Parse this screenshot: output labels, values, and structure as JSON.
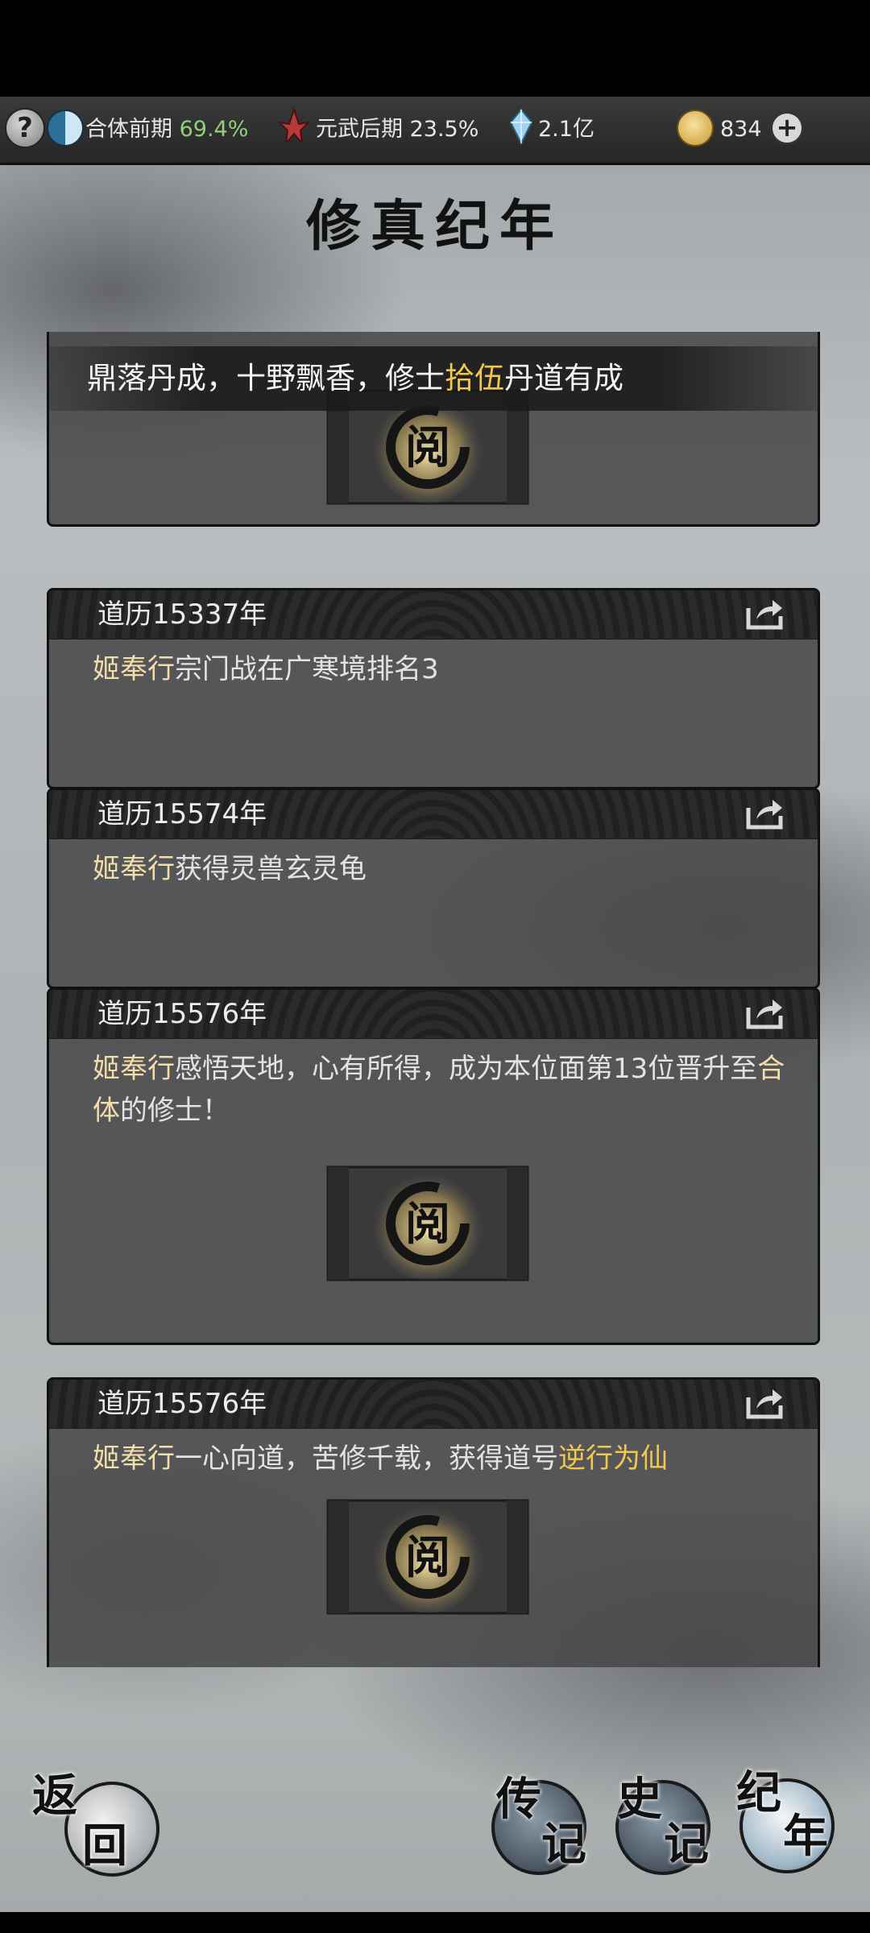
{
  "status_bar": {
    "cultivation_label": "合体前期",
    "cultivation_pct": "69.4%",
    "martial_label": "元武后期 23.5%",
    "spirit_stones": "2.1亿",
    "jade": "834",
    "help_glyph": "?",
    "plus_glyph": "+"
  },
  "title": "修真纪年",
  "banner": {
    "before": "鼎落丹成，十野飘香，修士",
    "highlight": "拾伍",
    "after": "丹道有成"
  },
  "events": [
    {
      "year": "道历15337年",
      "name": "姬奉行",
      "text": "宗门战在广寒境排名3",
      "has_scroll": false
    },
    {
      "year": "道历15574年",
      "name": "姬奉行",
      "text": "获得灵兽玄灵龟",
      "has_scroll": false
    },
    {
      "year": "道历15576年",
      "name": "姬奉行",
      "text_a": "感悟天地，心有所得，成为本位面第13位晋升至",
      "text_hl": "合体",
      "text_b": "的修士！",
      "has_scroll": true
    },
    {
      "year": "道历15576年",
      "name": "姬奉行",
      "text_a": "一心向道，苦修千载，获得道号",
      "text_hl": "逆行为仙",
      "has_scroll": true
    }
  ],
  "scroll_label": "阅",
  "nav": {
    "back_a": "返",
    "back_b": "回",
    "bio_a": "传",
    "bio_b": "记",
    "history_a": "史",
    "history_b": "记",
    "annals_a": "纪",
    "annals_b": "年"
  },
  "colors": {
    "highlight_gold": "#f0c84e",
    "name_cream": "#f3deaa",
    "percent_green": "#8fd07a"
  },
  "icons": [
    "help-icon",
    "yin-yang-icon",
    "red-flame-icon",
    "crystal-icon",
    "gold-coin-icon",
    "plus-icon",
    "share-icon"
  ]
}
